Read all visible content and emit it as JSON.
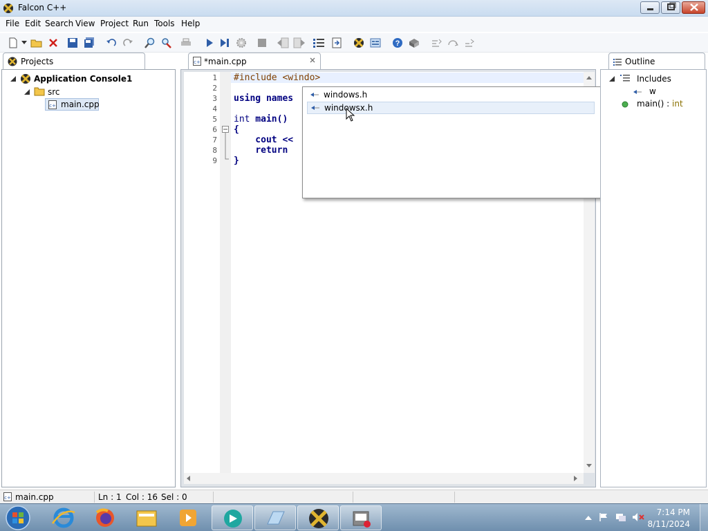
{
  "window": {
    "title": "Falcon C++"
  },
  "menu": [
    "File",
    "Edit",
    "Search",
    "View",
    "Project",
    "Run",
    "Tools",
    "Help"
  ],
  "projects": {
    "tab_label": "Projects",
    "tree": {
      "project": "Application Console1",
      "folder": "src",
      "file": "main.cpp"
    }
  },
  "editor": {
    "tab_label": "*main.cpp",
    "line_numbers": [
      "1",
      "2",
      "3",
      "4",
      "5",
      "6",
      "7",
      "8",
      "9"
    ],
    "lines": [
      {
        "parts": [
          {
            "c": "pp",
            "t": "#include <windo>"
          }
        ]
      },
      {
        "parts": []
      },
      {
        "parts": [
          {
            "c": "kw",
            "t": "using names"
          }
        ]
      },
      {
        "parts": []
      },
      {
        "parts": [
          {
            "c": "ty",
            "t": "int"
          },
          {
            "c": "",
            "t": " main()"
          }
        ]
      },
      {
        "parts": [
          {
            "c": "kw",
            "t": "{"
          }
        ]
      },
      {
        "parts": [
          {
            "c": "",
            "t": "    cout <<"
          }
        ]
      },
      {
        "parts": [
          {
            "c": "",
            "t": "    "
          },
          {
            "c": "kw",
            "t": "return"
          }
        ]
      },
      {
        "parts": [
          {
            "c": "kw",
            "t": "}"
          }
        ]
      }
    ]
  },
  "autocomplete": {
    "items": [
      "windows.h",
      "windowsx.h"
    ],
    "selected_index": 1
  },
  "outline": {
    "tab_label": "Outline",
    "includes_label": "Includes",
    "include_item": "w",
    "function_name": "main()",
    "function_sep": " : ",
    "function_type": "int"
  },
  "status": {
    "file": "main.cpp",
    "line": "Ln : 1",
    "col": "Col : 16",
    "sel": "Sel : 0"
  },
  "clock": {
    "time": "7:14 PM",
    "date": "8/11/2024"
  },
  "colors": {
    "accent": "#1a5fb4",
    "popup_selected": "#e8f0fa",
    "current_line": "#e8f0ff"
  }
}
